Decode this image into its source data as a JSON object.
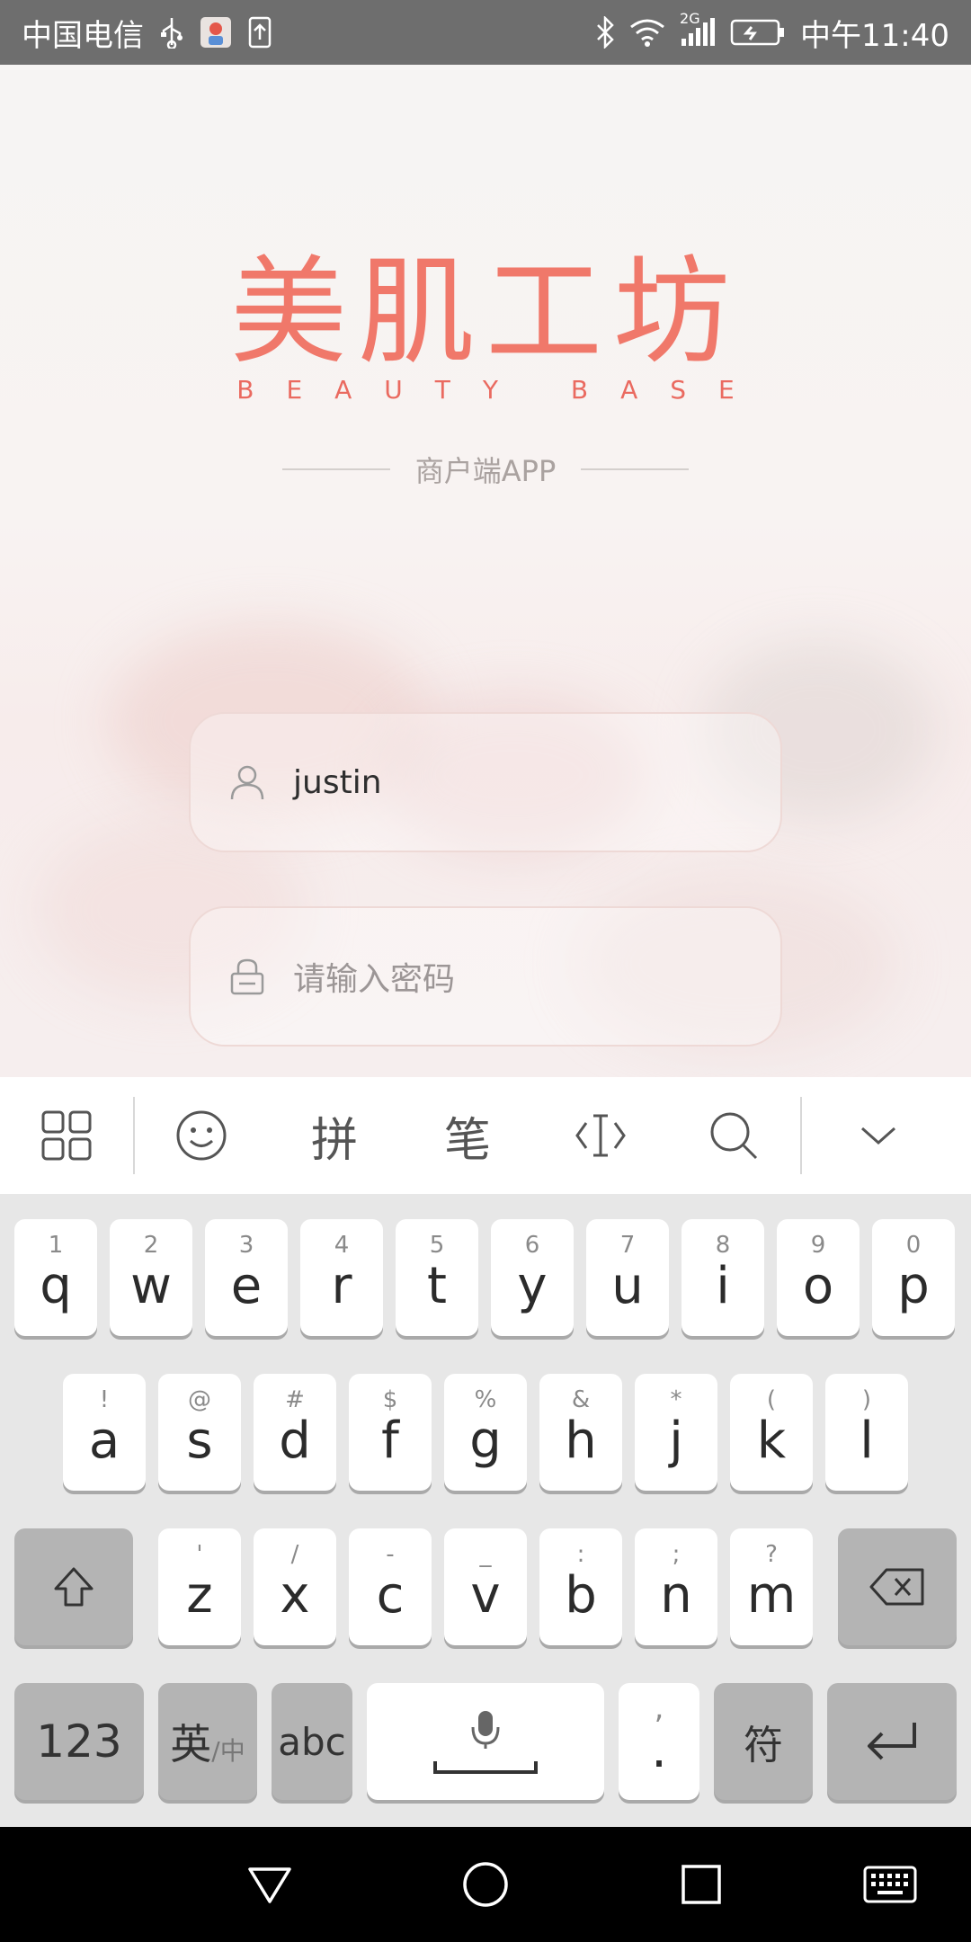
{
  "status_bar": {
    "carrier": "中国电信",
    "time": "中午11:40",
    "network": "2G",
    "icons_left": [
      "usb-icon",
      "app-notification-icon",
      "upload-icon"
    ],
    "icons_right": [
      "bluetooth-icon",
      "wifi-icon",
      "signal-icon",
      "battery-icon"
    ]
  },
  "app": {
    "logo_cn": "美肌工坊",
    "logo_en": "BEAUTY BASE",
    "subtitle": "商户端APP",
    "brand_color": "#f0786a"
  },
  "login": {
    "username_value": "justin",
    "password_placeholder": "请输入密码"
  },
  "ime_toolbar": {
    "items": [
      "menu-grid-icon",
      "emoji-icon",
      "拼",
      "笔",
      "cursor-icon",
      "search-icon",
      "collapse-chevron-icon"
    ]
  },
  "keyboard": {
    "row1": [
      {
        "main": "q",
        "sub": "1"
      },
      {
        "main": "w",
        "sub": "2"
      },
      {
        "main": "e",
        "sub": "3"
      },
      {
        "main": "r",
        "sub": "4"
      },
      {
        "main": "t",
        "sub": "5"
      },
      {
        "main": "y",
        "sub": "6"
      },
      {
        "main": "u",
        "sub": "7"
      },
      {
        "main": "i",
        "sub": "8"
      },
      {
        "main": "o",
        "sub": "9"
      },
      {
        "main": "p",
        "sub": "0"
      }
    ],
    "row2": [
      {
        "main": "a",
        "sub": "!"
      },
      {
        "main": "s",
        "sub": "@"
      },
      {
        "main": "d",
        "sub": "#"
      },
      {
        "main": "f",
        "sub": "$"
      },
      {
        "main": "g",
        "sub": "%"
      },
      {
        "main": "h",
        "sub": "&"
      },
      {
        "main": "j",
        "sub": "*"
      },
      {
        "main": "k",
        "sub": "("
      },
      {
        "main": "l",
        "sub": ")"
      }
    ],
    "row3": [
      {
        "main": "z",
        "sub": "'"
      },
      {
        "main": "x",
        "sub": "/"
      },
      {
        "main": "c",
        "sub": "-"
      },
      {
        "main": "v",
        "sub": "_"
      },
      {
        "main": "b",
        "sub": ":"
      },
      {
        "main": "n",
        "sub": ";"
      },
      {
        "main": "m",
        "sub": "?"
      }
    ],
    "num_key": "123",
    "lang_key_main": "英",
    "lang_key_sub": "/中",
    "abc_key": "abc",
    "period_key_main": ".",
    "period_key_sub": ",",
    "symbol_key": "符"
  },
  "nav_bar": {
    "buttons": [
      "back-triangle-icon",
      "home-circle-icon",
      "recents-square-icon",
      "keyboard-icon"
    ]
  }
}
